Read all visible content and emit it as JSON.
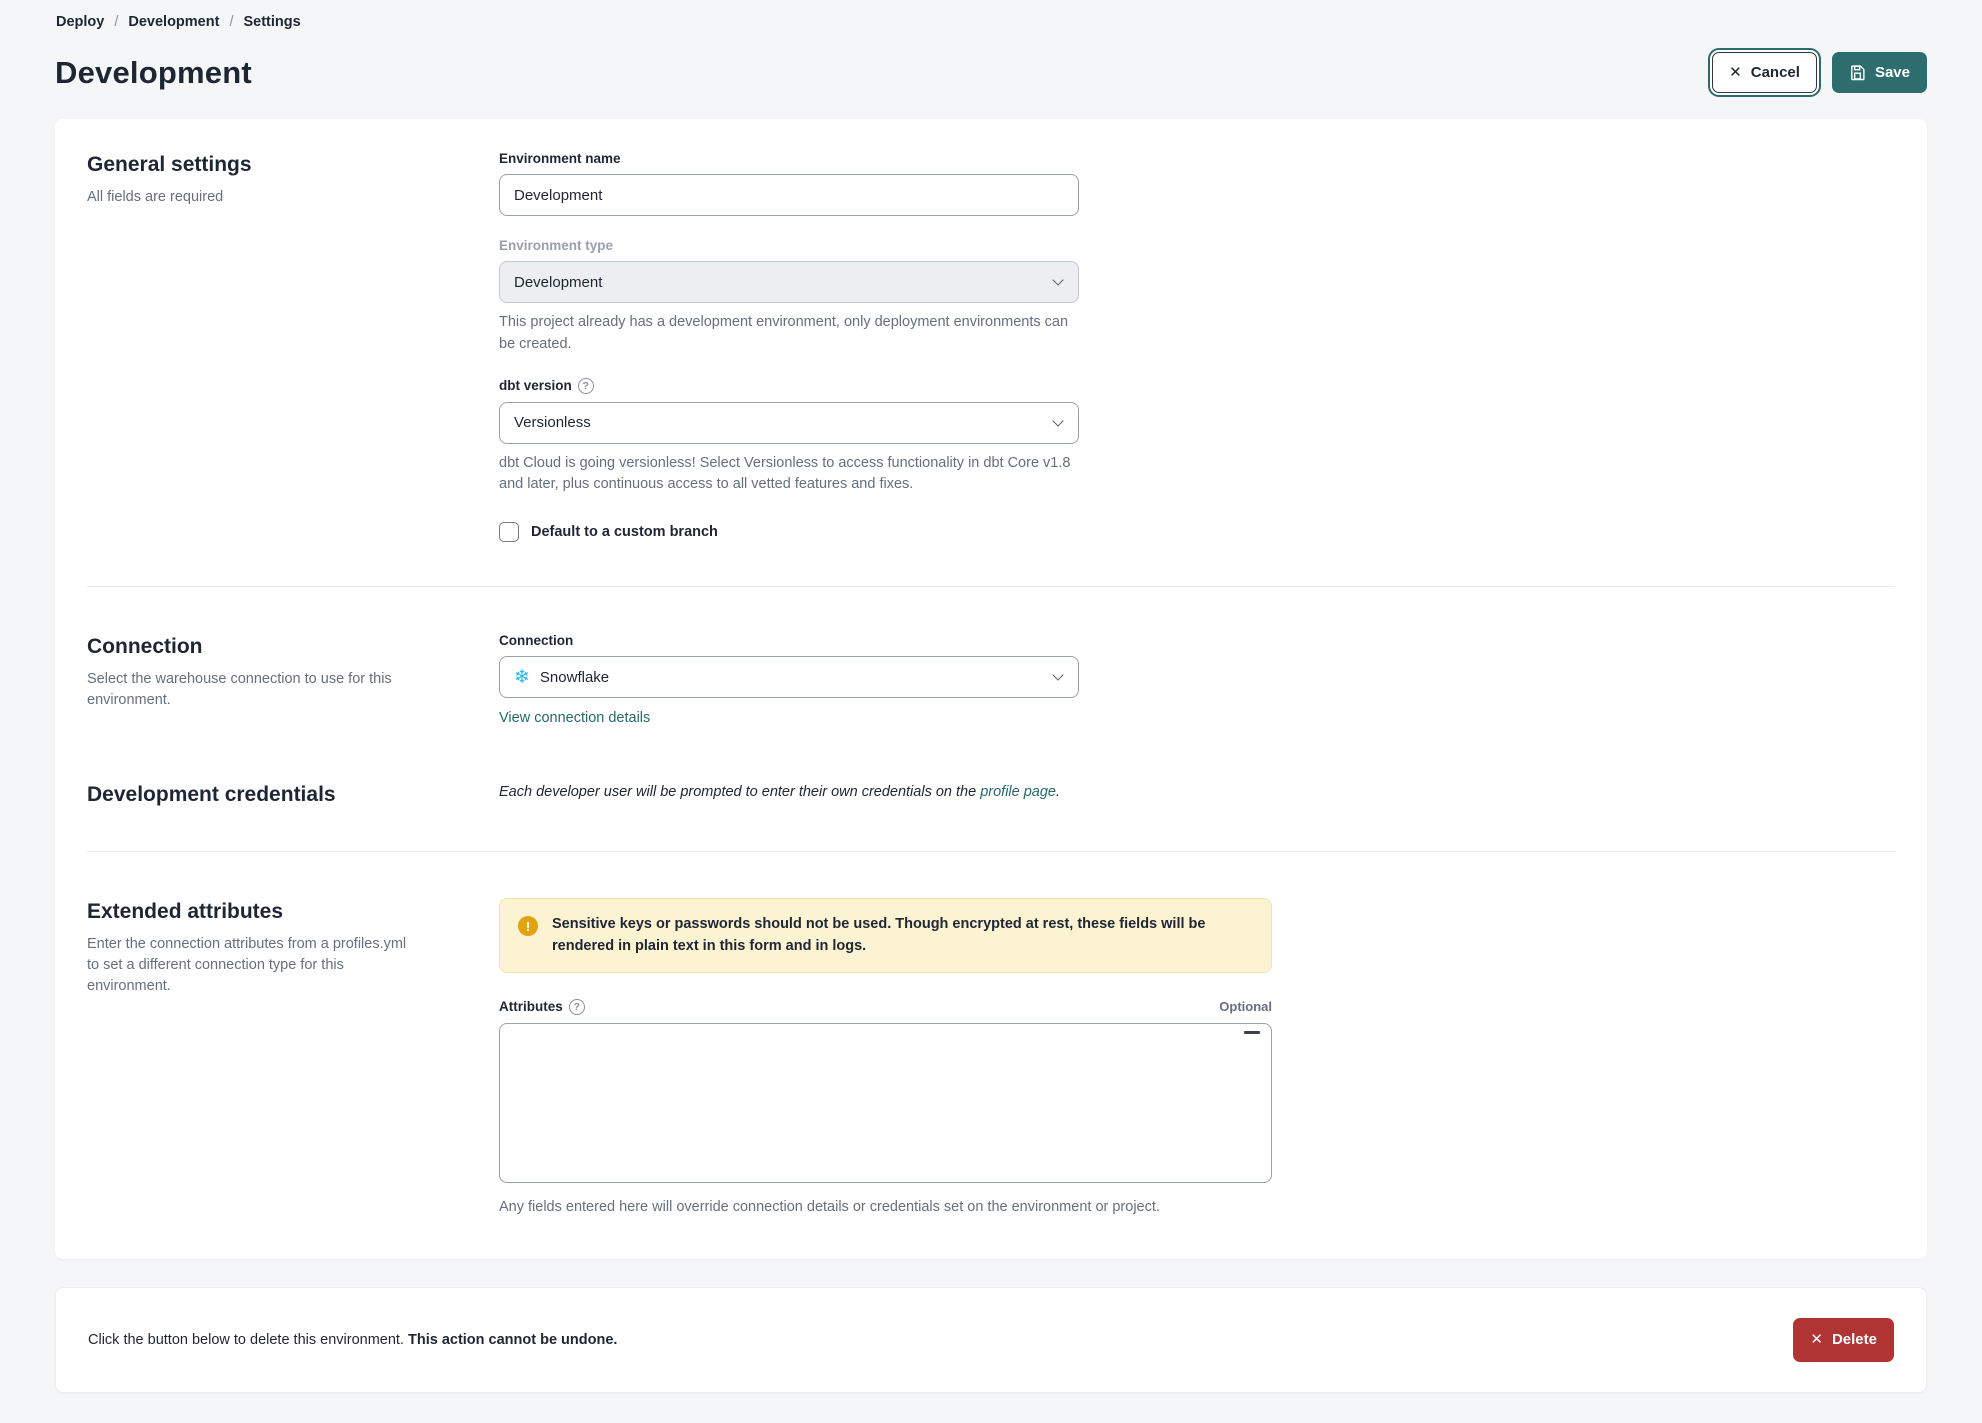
{
  "breadcrumb": {
    "items": [
      "Deploy",
      "Development",
      "Settings"
    ],
    "separator": "/"
  },
  "header": {
    "title": "Development",
    "cancel_label": "Cancel",
    "save_label": "Save"
  },
  "general": {
    "heading": "General settings",
    "subtitle": "All fields are required",
    "environment_name": {
      "label": "Environment name",
      "value": "Development"
    },
    "environment_type": {
      "label": "Environment type",
      "value": "Development",
      "helper": "This project already has a development environment, only deployment environments can be created."
    },
    "dbt_version": {
      "label": "dbt version",
      "value": "Versionless",
      "helper": "dbt Cloud is going versionless! Select Versionless to access functionality in dbt Core v1.8 and later, plus continuous access to all vetted features and fixes."
    },
    "custom_branch": {
      "label": "Default to a custom branch",
      "checked": false
    }
  },
  "connection": {
    "heading": "Connection",
    "subtitle": "Select the warehouse connection to use for this environment.",
    "field_label": "Connection",
    "value": "Snowflake",
    "snowflake_icon": "❄",
    "details_link": "View connection details"
  },
  "credentials": {
    "heading": "Development credentials",
    "text_before": "Each developer user will be prompted to enter their own credentials on the ",
    "link_label": "profile page",
    "text_after": "."
  },
  "extended": {
    "heading": "Extended attributes",
    "subtitle": "Enter the connection attributes from a profiles.yml to set a different connection type for this environment.",
    "warning_text": "Sensitive keys or passwords should not be used. Though encrypted at rest, these fields will be rendered in plain text in this form and in logs.",
    "warning_icon": "!",
    "attributes_label": "Attributes",
    "optional_label": "Optional",
    "attributes_value": "",
    "helper": "Any fields entered here will override connection details or credentials set on the environment or project."
  },
  "danger": {
    "text_before": "Click the button below to delete this environment. ",
    "text_bold": "This action cannot be undone.",
    "delete_label": "Delete"
  },
  "colors": {
    "accent_teal": "#2e6d6d",
    "danger_red": "#b13434",
    "link_teal": "#26696b",
    "warning_bg": "#fbf3d2",
    "warning_icon": "#e2a312",
    "snowflake_blue": "#29b5e8"
  },
  "help_glyph": "?"
}
